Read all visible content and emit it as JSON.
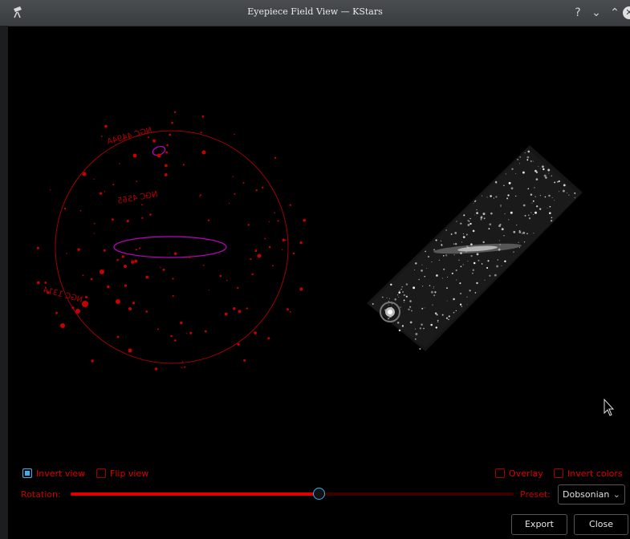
{
  "window": {
    "title": "Eyepiece Field View — KStars",
    "controls": {
      "help": "?",
      "minimize": "⌄",
      "maximize": "⌃",
      "close": "✕"
    }
  },
  "sky_chart": {
    "labels": [
      "NGC 4494A",
      "NGC 4565",
      "NGC 1314"
    ],
    "colors": {
      "chart_red": "#c80000",
      "galaxy_magenta": "#c000c0"
    }
  },
  "controls": {
    "invert_view": {
      "label": "Invert view",
      "checked": true
    },
    "flip_view": {
      "label": "Flip view",
      "checked": false
    },
    "overlay": {
      "label": "Overlay",
      "checked": false
    },
    "invert_colors": {
      "label": "Invert colors",
      "checked": false
    },
    "rotation": {
      "label": "Rotation:",
      "value_fraction": 0.56
    },
    "preset": {
      "label": "Preset:",
      "selected": "Dobsonian"
    },
    "export_label": "Export",
    "close_label": "Close"
  },
  "colors": {
    "accent": "#3daee9",
    "label_red": "#d80000"
  }
}
